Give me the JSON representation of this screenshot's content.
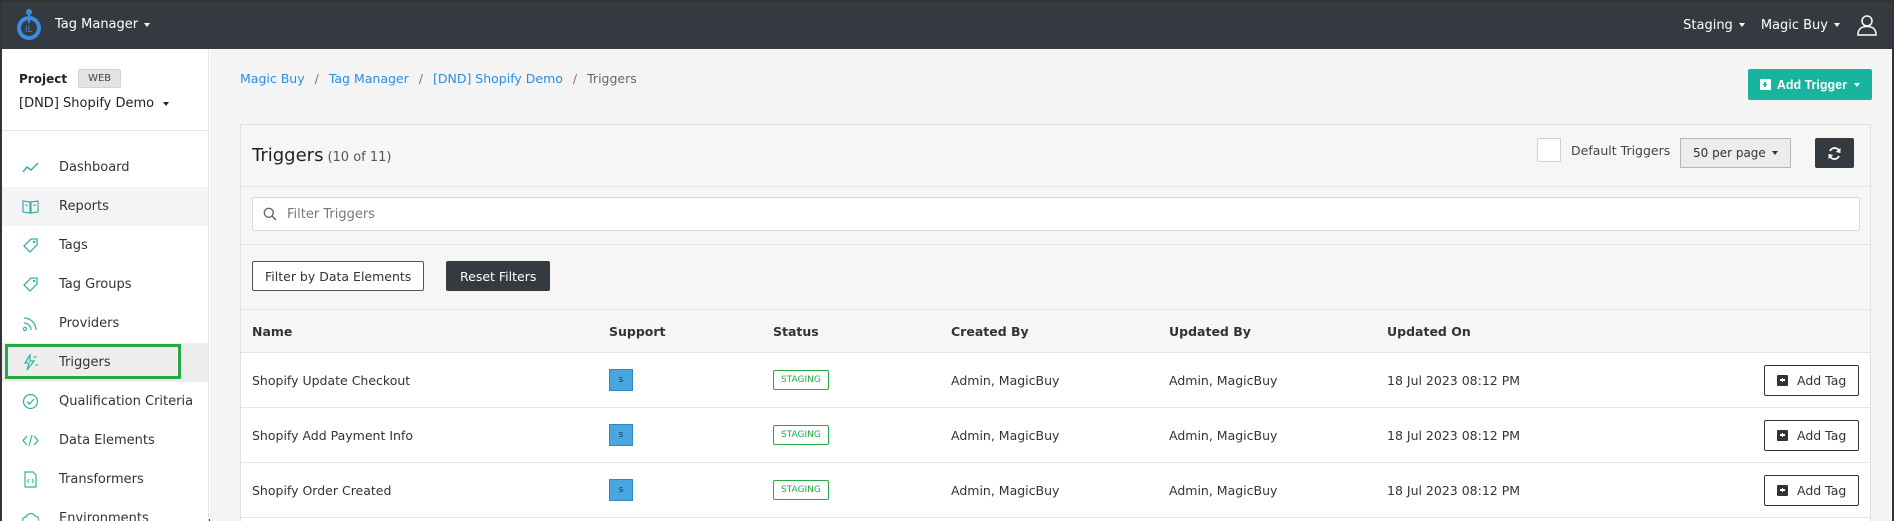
{
  "topbar": {
    "app_name": "Tag Manager",
    "env": "Staging",
    "account": "Magic Buy"
  },
  "sidebar": {
    "project_label": "Project",
    "project_badge": "WEB",
    "project_name": "[DND] Shopify Demo",
    "items": [
      {
        "label": "Dashboard",
        "icon": "chart-line-icon"
      },
      {
        "label": "Reports",
        "icon": "book-icon"
      },
      {
        "label": "Tags",
        "icon": "tag-icon"
      },
      {
        "label": "Tag Groups",
        "icon": "tags-icon"
      },
      {
        "label": "Providers",
        "icon": "rss-icon"
      },
      {
        "label": "Triggers",
        "icon": "bolt-icon"
      },
      {
        "label": "Qualification Criteria",
        "icon": "check-circle-icon"
      },
      {
        "label": "Data Elements",
        "icon": "code-icon"
      },
      {
        "label": "Transformers",
        "icon": "file-code-icon"
      },
      {
        "label": "Environments",
        "icon": "cloud-icon"
      }
    ],
    "active": "Triggers"
  },
  "breadcrumb": {
    "items": [
      "Magic Buy",
      "Tag Manager",
      "[DND] Shopify Demo"
    ],
    "current": "Triggers"
  },
  "actions": {
    "add_trigger": "Add Trigger"
  },
  "panel": {
    "title": "Triggers",
    "count": "(10 of 11)",
    "default_triggers_label": "Default Triggers",
    "per_page": "50 per page"
  },
  "filter": {
    "placeholder": "Filter Triggers",
    "by_data_elements": "Filter by Data Elements",
    "reset": "Reset Filters"
  },
  "table": {
    "headers": {
      "name": "Name",
      "support": "Support",
      "status": "Status",
      "created_by": "Created By",
      "updated_by": "Updated By",
      "updated_on": "Updated On"
    },
    "rows": [
      {
        "name": "Shopify Update Checkout",
        "support": "s",
        "status": "STAGING",
        "created_by": "Admin, MagicBuy",
        "updated_by": "Admin, MagicBuy",
        "updated_on": "18 Jul 2023 08:12 PM",
        "action": "Add Tag"
      },
      {
        "name": "Shopify Add Payment Info",
        "support": "s",
        "status": "STAGING",
        "created_by": "Admin, MagicBuy",
        "updated_by": "Admin, MagicBuy",
        "updated_on": "18 Jul 2023 08:12 PM",
        "action": "Add Tag"
      },
      {
        "name": "Shopify Order Created",
        "support": "s",
        "status": "STAGING",
        "created_by": "Admin, MagicBuy",
        "updated_by": "Admin, MagicBuy",
        "updated_on": "18 Jul 2023 08:12 PM",
        "action": "Add Tag"
      }
    ]
  },
  "colors": {
    "topbar": "#343a40",
    "accent": "#18b49d",
    "link": "#2b8de0",
    "status_green": "#28a745",
    "nav_icon": "#3ab0a6",
    "highlight_box": "#28a745"
  }
}
